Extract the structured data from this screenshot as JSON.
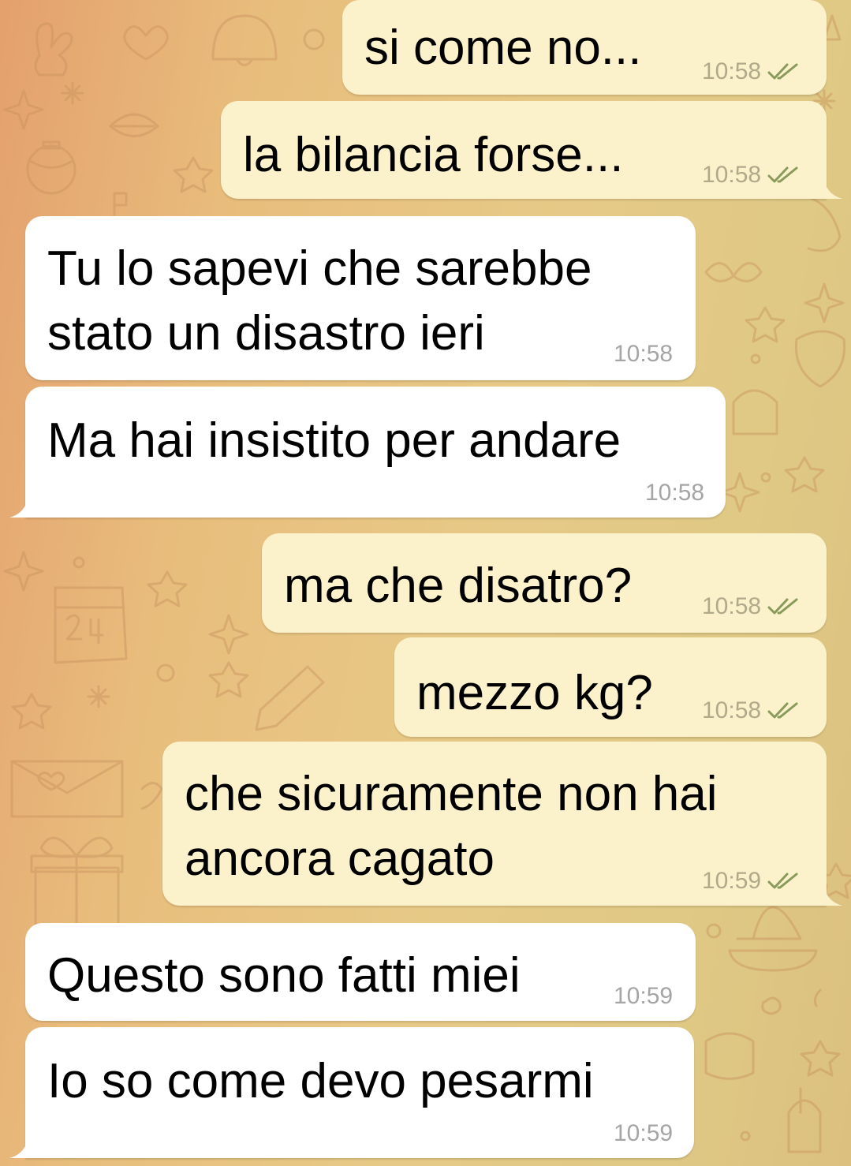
{
  "chat": {
    "messages": [
      {
        "direction": "out",
        "text": "si come no...",
        "time": "10:58",
        "status": "read"
      },
      {
        "direction": "out",
        "text": "la bilancia forse...",
        "time": "10:58",
        "status": "read"
      },
      {
        "direction": "in",
        "text": "Tu lo sapevi che sarebbe\nstato un disastro ieri",
        "time": "10:58"
      },
      {
        "direction": "in",
        "text": "Ma hai insistito per andare",
        "time": "10:58"
      },
      {
        "direction": "out",
        "text": "ma che disatro?",
        "time": "10:58",
        "status": "read"
      },
      {
        "direction": "out",
        "text": "mezzo kg?",
        "time": "10:58",
        "status": "read"
      },
      {
        "direction": "out",
        "text": "che sicuramente non hai\nancora cagato",
        "time": "10:59",
        "status": "read"
      },
      {
        "direction": "in",
        "text": "Questo sono fatti miei",
        "time": "10:59"
      },
      {
        "direction": "in",
        "text": "Io so come devo pesarmi",
        "time": "10:59"
      }
    ]
  },
  "colors": {
    "outgoing_bubble": "#fbf2cc",
    "incoming_bubble": "#ffffff",
    "read_check": "#8a9a5b",
    "wallpaper_doodle": "#c9925f"
  },
  "icons": {
    "read_status": "double-check-icon",
    "wallpaper": "doodle-pattern"
  }
}
